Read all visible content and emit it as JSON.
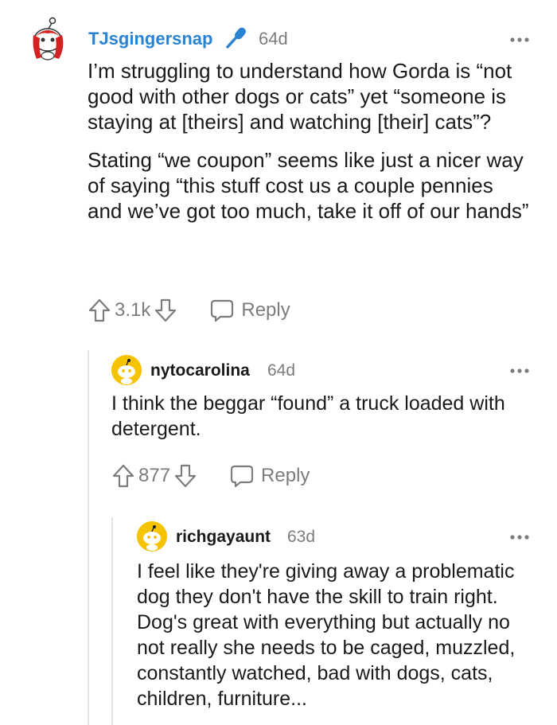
{
  "comments": [
    {
      "username": "TJsgingersnap",
      "time": "64d",
      "paragraphs": [
        "I’m struggling to understand how Gorda is “not good with other dogs or cats” yet “someone is staying at [theirs] and watching [their] cats”?",
        "Stating “we coupon” seems like just a nicer way of saying “this stuff cost us a couple pennies and we’ve got too much, take it off of our hands”"
      ],
      "votes": "3.1k",
      "reply_label": "Reply",
      "username_color": "#2a82d2",
      "award_icon": "microphone-icon"
    },
    {
      "username": "nytocarolina",
      "time": "64d",
      "paragraphs": [
        "I think the beggar “found” a truck loaded with detergent."
      ],
      "votes": "877",
      "reply_label": "Reply"
    },
    {
      "username": "richgayaunt",
      "time": "63d",
      "paragraphs": [
        "I feel like they're giving away a problematic dog they don't have the skill to train right. Dog's great with everything but actually no not really she needs to be caged, muzzled, constantly watched, bad with dogs, cats, children, furniture..."
      ]
    }
  ],
  "colors": {
    "meta": "#7c7c7c",
    "text": "#1a1a1b",
    "avatar_yellow": "#f5c300",
    "thread_line": "#e4e4e4"
  }
}
